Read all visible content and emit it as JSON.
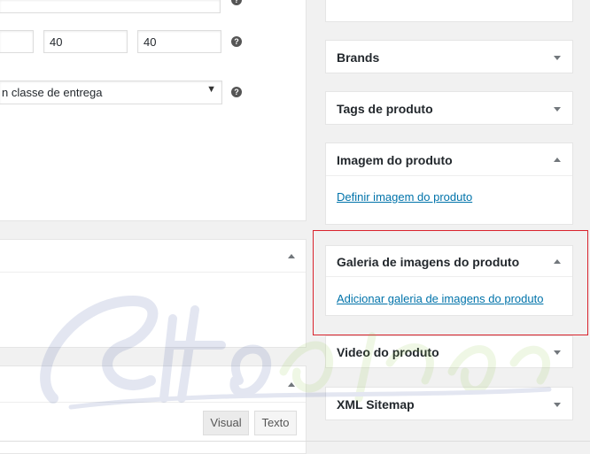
{
  "form": {
    "dimension_width": "40",
    "dimension_height": "40",
    "shipping_class_value": "n classe de entrega",
    "help_glyph": "?"
  },
  "sidebar": {
    "brands": "Brands",
    "tags": "Tags de produto",
    "image_title": "Imagem do produto",
    "image_link": "Definir imagem do produto",
    "gallery_title": "Galeria de imagens do produto",
    "gallery_link": "Adicionar galeria de imagens do produto",
    "video": "Video do produto",
    "sitemap": "XML Sitemap"
  },
  "editor": {
    "tab_visual": "Visual",
    "tab_text": "Texto"
  },
  "colors": {
    "link": "#0073aa",
    "highlight": "#d9232d"
  }
}
